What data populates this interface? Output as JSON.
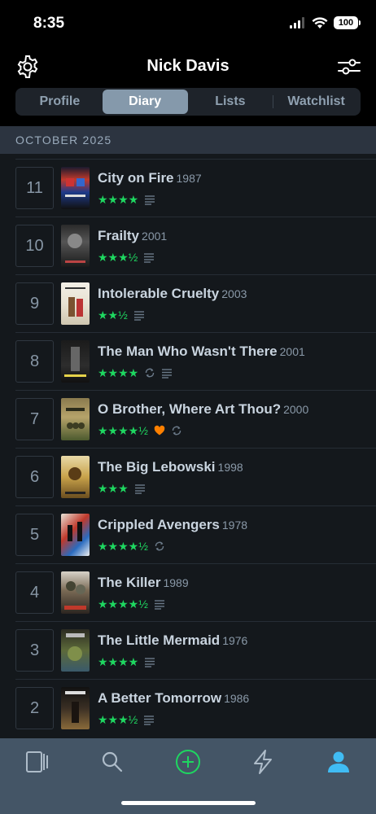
{
  "status": {
    "time": "8:35",
    "battery": "100"
  },
  "header": {
    "title": "Nick Davis"
  },
  "tabs": [
    "Profile",
    "Diary",
    "Lists",
    "Watchlist"
  ],
  "section": {
    "month": "OCTOBER 2025"
  },
  "colors": {
    "accent_green": "#1ed760",
    "like_orange": "#ff8000",
    "active_tab_blue": "#40bcf4"
  },
  "entries": [
    {
      "day": "11",
      "title": "City on Fire",
      "year": "1987",
      "rating": 4,
      "rating_stars": "★★★★",
      "liked": false,
      "rewatch": false,
      "review": true
    },
    {
      "day": "10",
      "title": "Frailty",
      "year": "2001",
      "rating": 3.5,
      "rating_stars": "★★★½",
      "liked": false,
      "rewatch": false,
      "review": true
    },
    {
      "day": "9",
      "title": "Intolerable Cruelty",
      "year": "2003",
      "rating": 2.5,
      "rating_stars": "★★½",
      "liked": false,
      "rewatch": false,
      "review": true
    },
    {
      "day": "8",
      "title": "The Man Who Wasn't There",
      "year": "2001",
      "rating": 4,
      "rating_stars": "★★★★",
      "liked": false,
      "rewatch": true,
      "review": true
    },
    {
      "day": "7",
      "title": "O Brother, Where Art Thou?",
      "year": "2000",
      "rating": 4.5,
      "rating_stars": "★★★★½",
      "liked": true,
      "rewatch": true,
      "review": false
    },
    {
      "day": "6",
      "title": "The Big Lebowski",
      "year": "1998",
      "rating": 3,
      "rating_stars": "★★★",
      "liked": false,
      "rewatch": false,
      "review": true
    },
    {
      "day": "5",
      "title": "Crippled Avengers",
      "year": "1978",
      "rating": 4.5,
      "rating_stars": "★★★★½",
      "liked": false,
      "rewatch": true,
      "review": false
    },
    {
      "day": "4",
      "title": "The Killer",
      "year": "1989",
      "rating": 4.5,
      "rating_stars": "★★★★½",
      "liked": false,
      "rewatch": false,
      "review": true
    },
    {
      "day": "3",
      "title": "The Little Mermaid",
      "year": "1976",
      "rating": 4,
      "rating_stars": "★★★★",
      "liked": false,
      "rewatch": false,
      "review": true
    },
    {
      "day": "2",
      "title": "A Better Tomorrow",
      "year": "1986",
      "rating": 3.5,
      "rating_stars": "★★★½",
      "liked": false,
      "rewatch": false,
      "review": true
    }
  ],
  "tabbar": [
    "films-icon",
    "search-icon",
    "add-icon",
    "activity-icon",
    "profile-icon"
  ]
}
